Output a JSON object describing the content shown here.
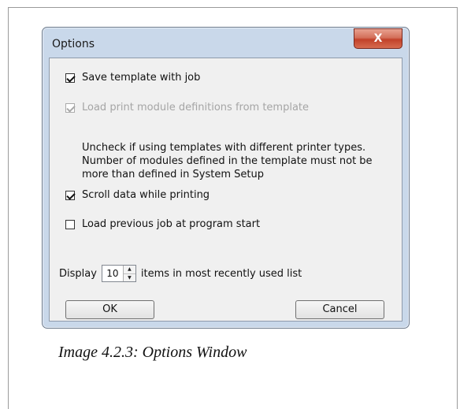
{
  "window": {
    "title": "Options",
    "close_label": "X"
  },
  "options": {
    "save_template": {
      "label": "Save template with job",
      "checked": true,
      "enabled": true
    },
    "load_print_module": {
      "label": "Load print module definitions from template",
      "checked": true,
      "enabled": false
    },
    "note": "Uncheck if using templates with different printer types. Number of modules defined in the template must not be more than defined in System Setup",
    "scroll_data": {
      "label": "Scroll data while printing",
      "checked": true,
      "enabled": true
    },
    "load_previous_job": {
      "label": "Load previous job at program start",
      "checked": false,
      "enabled": true
    }
  },
  "mru": {
    "prefix": "Display",
    "value": "10",
    "suffix": "items in most recently used list"
  },
  "buttons": {
    "ok": "OK",
    "cancel": "Cancel"
  },
  "caption": "Image 4.2.3: Options Window",
  "colors": {
    "close_button": "#c94a33",
    "title_frame": "#c9d8ea",
    "client_bg": "#f0f0f0"
  },
  "icons": {
    "spin_up": "triangle-up",
    "spin_down": "triangle-down"
  }
}
